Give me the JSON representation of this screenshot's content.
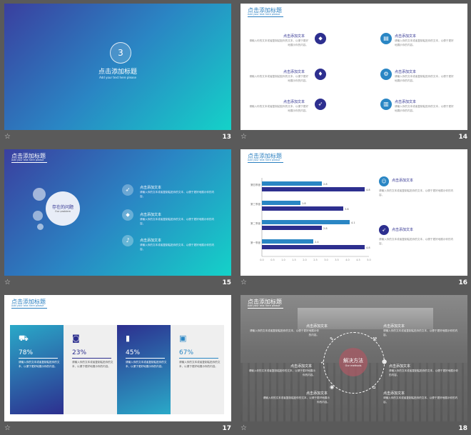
{
  "common": {
    "title": "点击添加标题",
    "subtitle": "Add your text here please",
    "item_heading": "点击添加文本",
    "item_body": "请输入你的文本或者复制粘贴你的文本，以便于更好地展示你的内容。",
    "star": "☆"
  },
  "slides": {
    "s13": {
      "number": "13",
      "section": "3",
      "title": "点击添加标题",
      "subtitle": "Add your text here please"
    },
    "s14": {
      "number": "14"
    },
    "s15": {
      "number": "15",
      "circle_title": "存在的问题",
      "circle_sub": "Our problem"
    },
    "s16": {
      "number": "16",
      "chart_data": {
        "type": "bar",
        "categories": [
          "第四季度",
          "第三季度",
          "第二季度",
          "第一季度"
        ],
        "series": [
          {
            "values": [
              2.8,
              1.8,
              4.1,
              2.4
            ]
          },
          {
            "values": [
              4.8,
              3.8,
              2.8,
              4.8
            ]
          }
        ],
        "xticks": [
          "0.0",
          "0.5",
          "1.0",
          "1.5",
          "2.0",
          "2.5",
          "3.0",
          "3.5",
          "4.0",
          "4.5",
          "5.0"
        ],
        "xlim": [
          0,
          5
        ]
      }
    },
    "s17": {
      "number": "17",
      "percents": [
        "78%",
        "23%",
        "45%",
        "67%"
      ]
    },
    "s18": {
      "number": "18",
      "center_title": "解决方法",
      "center_sub": "Our methods"
    }
  },
  "colors": {
    "navy": "#2d2f8f",
    "blue": "#2a86c4",
    "teal": "#14d2c8"
  }
}
